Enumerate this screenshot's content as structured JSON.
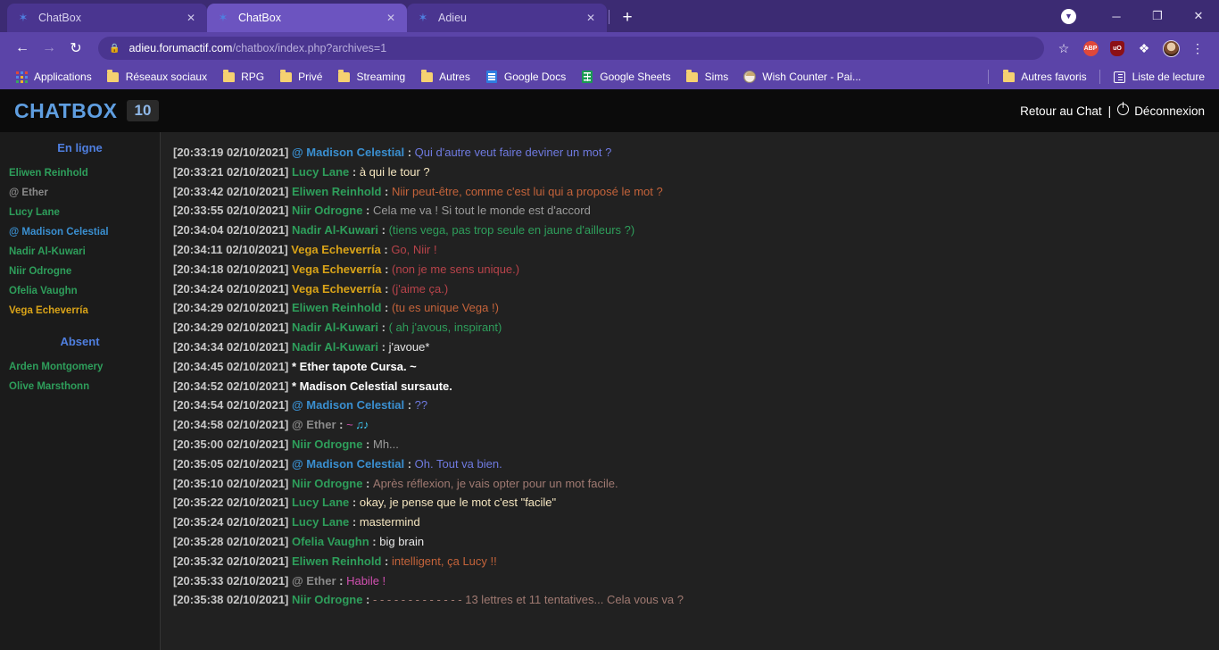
{
  "browser": {
    "tabs": [
      {
        "title": "ChatBox",
        "favicon": "star-icon",
        "active": false,
        "close_label": "✕"
      },
      {
        "title": "ChatBox",
        "favicon": "star-icon",
        "active": true,
        "close_label": "✕"
      },
      {
        "title": "Adieu",
        "favicon": "star-icon",
        "active": false,
        "close_label": "✕"
      }
    ],
    "new_tab_label": "+",
    "window_controls": {
      "downloads": "▼",
      "minimize": "─",
      "maximize": "❐",
      "close": "✕"
    },
    "nav": {
      "back": "←",
      "forward": "→",
      "reload": "↻"
    },
    "omnibox": {
      "lock_icon": "lock-icon",
      "host": "adieu.forumactif.com",
      "path": "/chatbox/index.php?archives=1",
      "full_url": "adieu.forumactif.com/chatbox/index.php?archives=1"
    },
    "toolbar_icons": [
      {
        "name": "bookmark-star-icon",
        "glyph": "☆"
      },
      {
        "name": "adblock-plus-icon",
        "glyph": "ABP"
      },
      {
        "name": "ublock-origin-icon",
        "glyph": "uO"
      },
      {
        "name": "extensions-puzzle-icon",
        "glyph": "❖"
      },
      {
        "name": "profile-avatar-icon",
        "glyph": ""
      },
      {
        "name": "chrome-menu-icon",
        "glyph": "⋮"
      }
    ],
    "bookmarks": [
      {
        "label": "Applications",
        "icon": "apps-grid-icon"
      },
      {
        "label": "Réseaux sociaux",
        "icon": "folder-icon"
      },
      {
        "label": "RPG",
        "icon": "folder-icon"
      },
      {
        "label": "Privé",
        "icon": "folder-icon"
      },
      {
        "label": "Streaming",
        "icon": "folder-icon"
      },
      {
        "label": "Autres",
        "icon": "folder-icon"
      },
      {
        "label": "Google Docs",
        "icon": "google-docs-icon"
      },
      {
        "label": "Google Sheets",
        "icon": "google-sheets-icon"
      },
      {
        "label": "Sims",
        "icon": "folder-icon"
      },
      {
        "label": "Wish Counter - Pai...",
        "icon": "wish-counter-icon"
      }
    ],
    "bookmarks_right": [
      {
        "label": "Autres favoris",
        "icon": "folder-icon"
      },
      {
        "label": "Liste de lecture",
        "icon": "reading-list-icon"
      }
    ]
  },
  "chatbox": {
    "title": "CHATBOX",
    "count": "10",
    "back_to_chat": "Retour au Chat",
    "separator": "|",
    "logout": "Déconnexion",
    "logout_icon": "power-icon"
  },
  "colors": {
    "accent_blue": "#4f7fe0",
    "title_blue": "#5f9ee0",
    "green": "#2e9e5b",
    "gray_user": "#8a8a8a",
    "blue_user": "#3a8fd0",
    "gold_user": "#d9a318",
    "orange_text": "#c4633a",
    "red_text": "#b8434a",
    "pink_text": "#d050b0",
    "chat_bg": "#212121",
    "header_bg": "#0b0b0b",
    "sidebar_bg": "#1b1b1b"
  },
  "sidebar": {
    "online_header": "En ligne",
    "away_header": "Absent",
    "online": [
      {
        "name": "Eliwen Reinhold",
        "color": "#2e9e5b"
      },
      {
        "name": "@ Ether",
        "color": "#8a8a8a"
      },
      {
        "name": "Lucy Lane",
        "color": "#2e9e5b"
      },
      {
        "name": "@ Madison Celestial",
        "color": "#3a8fd0"
      },
      {
        "name": "Nadir Al-Kuwari",
        "color": "#2e9e5b"
      },
      {
        "name": "Niir Odrogne",
        "color": "#2e9e5b"
      },
      {
        "name": "Ofelia Vaughn",
        "color": "#2e9e5b"
      },
      {
        "name": "Vega Echeverría",
        "color": "#d9a318"
      }
    ],
    "away": [
      {
        "name": "Arden Montgomery",
        "color": "#2e9e5b"
      },
      {
        "name": "Olive Marsthonn",
        "color": "#2e9e5b"
      }
    ]
  },
  "messages": [
    {
      "clipped": true,
      "timestamp": "",
      "author": "",
      "author_color": "",
      "text": "",
      "text_color": ""
    },
    {
      "timestamp": "[20:33:19 02/10/2021]",
      "author": "@ Madison Celestial",
      "author_color": "#3a8fd0",
      "text": "Qui d'autre veut faire deviner un mot ?",
      "text_color": "#6f7ae0"
    },
    {
      "timestamp": "[20:33:21 02/10/2021]",
      "author": "Lucy Lane",
      "author_color": "#2e9e5b",
      "text": "à qui le tour ?",
      "text_color": "#f5e6c0"
    },
    {
      "timestamp": "[20:33:42 02/10/2021]",
      "author": "Eliwen Reinhold",
      "author_color": "#2e9e5b",
      "text": "Niir peut-être, comme c'est lui qui a proposé le mot ?",
      "text_color": "#c4633a"
    },
    {
      "timestamp": "[20:33:55 02/10/2021]",
      "author": "Niir Odrogne",
      "author_color": "#2e9e5b",
      "text": "Cela me va ! Si tout le monde est d'accord",
      "text_color": "#9c9c9c"
    },
    {
      "timestamp": "[20:34:04 02/10/2021]",
      "author": "Nadir Al-Kuwari",
      "author_color": "#2e9e5b",
      "text": "(tiens vega, pas trop seule en jaune d'ailleurs ?)",
      "text_color": "#2e9e5b"
    },
    {
      "timestamp": "[20:34:11 02/10/2021]",
      "author": "Vega Echeverría",
      "author_color": "#d9a318",
      "text": "Go, Niir !",
      "text_color": "#b8434a"
    },
    {
      "timestamp": "[20:34:18 02/10/2021]",
      "author": "Vega Echeverría",
      "author_color": "#d9a318",
      "text": "(non je me sens unique.)",
      "text_color": "#b8434a"
    },
    {
      "timestamp": "[20:34:24 02/10/2021]",
      "author": "Vega Echeverría",
      "author_color": "#d9a318",
      "text": "(j'aime ça.)",
      "text_color": "#b8434a"
    },
    {
      "timestamp": "[20:34:29 02/10/2021]",
      "author": "Eliwen Reinhold",
      "author_color": "#2e9e5b",
      "text": "(tu es unique Vega !)",
      "text_color": "#c4633a"
    },
    {
      "timestamp": "[20:34:29 02/10/2021]",
      "author": "Nadir Al-Kuwari",
      "author_color": "#2e9e5b",
      "text": "( ah j'avous, inspirant)",
      "text_color": "#2e9e5b"
    },
    {
      "timestamp": "[20:34:34 02/10/2021]",
      "author": "Nadir Al-Kuwari",
      "author_color": "#2e9e5b",
      "text": "j'avoue*",
      "text_color": "#e8e8e8"
    },
    {
      "action": true,
      "timestamp": "[20:34:45 02/10/2021]",
      "author": "",
      "author_color": "",
      "text": "* Ether tapote Cursa. ~",
      "text_color": "#ffffff"
    },
    {
      "action": true,
      "timestamp": "[20:34:52 02/10/2021]",
      "author": "",
      "author_color": "",
      "text": "* Madison Celestial sursaute.",
      "text_color": "#ffffff"
    },
    {
      "timestamp": "[20:34:54 02/10/2021]",
      "author": "@ Madison Celestial",
      "author_color": "#3a8fd0",
      "text": "??",
      "text_color": "#6f7ae0"
    },
    {
      "timestamp": "[20:34:58 02/10/2021]",
      "author": "@ Ether",
      "author_color": "#8a8a8a",
      "text": "~",
      "text_color": "#d050b0",
      "emoji": "music-note-emoji"
    },
    {
      "timestamp": "[20:35:00 02/10/2021]",
      "author": "Niir Odrogne",
      "author_color": "#2e9e5b",
      "text": "Mh...",
      "text_color": "#9c9c9c"
    },
    {
      "timestamp": "[20:35:05 02/10/2021]",
      "author": "@ Madison Celestial",
      "author_color": "#3a8fd0",
      "text": "Oh. Tout va bien.",
      "text_color": "#6f7ae0"
    },
    {
      "timestamp": "[20:35:10 02/10/2021]",
      "author": "Niir Odrogne",
      "author_color": "#2e9e5b",
      "text": "Après réflexion, je vais opter pour un mot facile.",
      "text_color": "#a07a72"
    },
    {
      "timestamp": "[20:35:22 02/10/2021]",
      "author": "Lucy Lane",
      "author_color": "#2e9e5b",
      "text": "okay, je pense que le mot c'est \"facile\"",
      "text_color": "#f5e6c0"
    },
    {
      "timestamp": "[20:35:24 02/10/2021]",
      "author": "Lucy Lane",
      "author_color": "#2e9e5b",
      "text": "mastermind",
      "text_color": "#f5e6c0"
    },
    {
      "timestamp": "[20:35:28 02/10/2021]",
      "author": "Ofelia Vaughn",
      "author_color": "#2e9e5b",
      "text": "big brain",
      "text_color": "#e8e8e8"
    },
    {
      "timestamp": "[20:35:32 02/10/2021]",
      "author": "Eliwen Reinhold",
      "author_color": "#2e9e5b",
      "text": "intelligent, ça Lucy !!",
      "text_color": "#c4633a"
    },
    {
      "timestamp": "[20:35:33 02/10/2021]",
      "author": "@ Ether",
      "author_color": "#8a8a8a",
      "text": "Habile !",
      "text_color": "#d050b0"
    },
    {
      "timestamp": "[20:35:38 02/10/2021]",
      "author": "Niir Odrogne",
      "author_color": "#2e9e5b",
      "text": "- - - - - - - - - - - - - 13 lettres et 11 tentatives... Cela vous va ?",
      "text_color": "#a07a72"
    }
  ]
}
